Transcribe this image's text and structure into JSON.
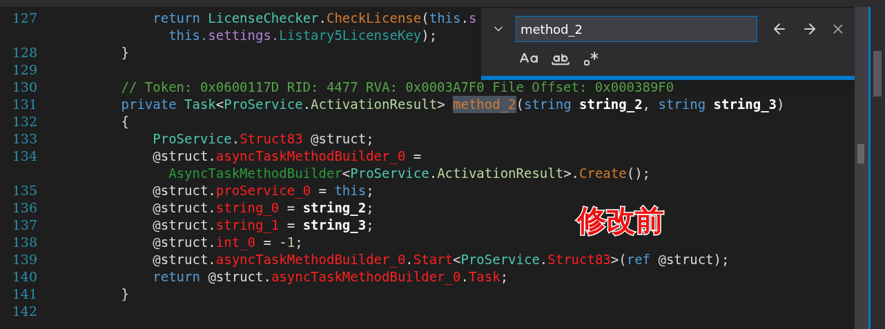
{
  "editor": {
    "lines": [
      {
        "number": "127",
        "tokens": [
          {
            "kind": "keyword",
            "text": "            return "
          },
          {
            "kind": "type",
            "text": "LicenseChecker"
          },
          {
            "kind": "plain",
            "text": "."
          },
          {
            "kind": "method",
            "text": "CheckLicense"
          },
          {
            "kind": "plain",
            "text": "("
          },
          {
            "kind": "keyword",
            "text": "this"
          },
          {
            "kind": "plain",
            "text": "."
          },
          {
            "kind": "property",
            "text": "s"
          }
        ]
      },
      {
        "tokens": [
          {
            "kind": "keyword",
            "text": "              this."
          },
          {
            "kind": "property",
            "text": "settings."
          },
          {
            "kind": "member",
            "text": "Listary5LicenseKey"
          },
          {
            "kind": "plain",
            "text": ");"
          }
        ]
      },
      {
        "number": "128",
        "tokens": [
          {
            "kind": "plain",
            "text": "        }"
          }
        ]
      },
      {
        "number": "129"
      },
      {
        "number": "130",
        "tokens": [
          {
            "kind": "comment",
            "text": "        // Token: 0x0600117D RID: 4477 RVA: 0x0003A7F0 File Offset: 0x000389F0"
          }
        ]
      },
      {
        "number": "131",
        "tokens": [
          {
            "kind": "keyword",
            "text": "        private "
          },
          {
            "kind": "type",
            "text": "Task"
          },
          {
            "kind": "plain",
            "text": "<"
          },
          {
            "kind": "type",
            "text": "ProService"
          },
          {
            "kind": "plain",
            "text": "."
          },
          {
            "kind": "nested",
            "text": "ActivationResult"
          },
          {
            "kind": "plain",
            "text": "> "
          },
          {
            "kind": "match",
            "text": "method_2"
          },
          {
            "kind": "plain",
            "text": "("
          },
          {
            "kind": "keyword",
            "text": "string "
          },
          {
            "kind": "param",
            "text": "string_2"
          },
          {
            "kind": "plain",
            "text": ", "
          },
          {
            "kind": "keyword",
            "text": "string "
          },
          {
            "kind": "param",
            "text": "string_3"
          },
          {
            "kind": "plain",
            "text": ")"
          }
        ]
      },
      {
        "number": "132",
        "tokens": [
          {
            "kind": "plain",
            "text": "        {"
          }
        ]
      },
      {
        "number": "133",
        "tokens": [
          {
            "kind": "type",
            "text": "            ProService"
          },
          {
            "kind": "plain",
            "text": "."
          },
          {
            "kind": "field",
            "text": "Struct83"
          },
          {
            "kind": "plain",
            "text": " @struct;"
          }
        ]
      },
      {
        "number": "134",
        "tokens": [
          {
            "kind": "plain",
            "text": "            @struct."
          },
          {
            "kind": "field",
            "text": "asyncTaskMethodBuilder_0"
          },
          {
            "kind": "plain",
            "text": " ="
          }
        ]
      },
      {
        "tokens": [
          {
            "kind": "struct",
            "text": "              AsyncTaskMethodBuilder"
          },
          {
            "kind": "plain",
            "text": "<"
          },
          {
            "kind": "type",
            "text": "ProService"
          },
          {
            "kind": "plain",
            "text": "."
          },
          {
            "kind": "nested",
            "text": "ActivationResult"
          },
          {
            "kind": "plain",
            "text": ">."
          },
          {
            "kind": "method",
            "text": "Create"
          },
          {
            "kind": "plain",
            "text": "();"
          }
        ]
      },
      {
        "number": "135",
        "tokens": [
          {
            "kind": "plain",
            "text": "            @struct."
          },
          {
            "kind": "field",
            "text": "proService_0"
          },
          {
            "kind": "plain",
            "text": " = "
          },
          {
            "kind": "keyword",
            "text": "this"
          },
          {
            "kind": "plain",
            "text": ";"
          }
        ]
      },
      {
        "number": "136",
        "tokens": [
          {
            "kind": "plain",
            "text": "            @struct."
          },
          {
            "kind": "field",
            "text": "string_0"
          },
          {
            "kind": "plain",
            "text": " = "
          },
          {
            "kind": "param",
            "text": "string_2"
          },
          {
            "kind": "plain",
            "text": ";"
          }
        ]
      },
      {
        "number": "137",
        "tokens": [
          {
            "kind": "plain",
            "text": "            @struct."
          },
          {
            "kind": "field",
            "text": "string_1"
          },
          {
            "kind": "plain",
            "text": " = "
          },
          {
            "kind": "param",
            "text": "string_3"
          },
          {
            "kind": "plain",
            "text": ";"
          }
        ]
      },
      {
        "number": "138",
        "tokens": [
          {
            "kind": "plain",
            "text": "            @struct."
          },
          {
            "kind": "field",
            "text": "int_0"
          },
          {
            "kind": "plain",
            "text": " = -"
          },
          {
            "kind": "number",
            "text": "1"
          },
          {
            "kind": "plain",
            "text": ";"
          }
        ]
      },
      {
        "number": "139",
        "tokens": [
          {
            "kind": "plain",
            "text": "            @struct."
          },
          {
            "kind": "field",
            "text": "asyncTaskMethodBuilder_0"
          },
          {
            "kind": "plain",
            "text": "."
          },
          {
            "kind": "field",
            "text": "Start"
          },
          {
            "kind": "plain",
            "text": "<"
          },
          {
            "kind": "type",
            "text": "ProService"
          },
          {
            "kind": "plain",
            "text": "."
          },
          {
            "kind": "field",
            "text": "Struct83"
          },
          {
            "kind": "plain",
            "text": ">("
          },
          {
            "kind": "keyword",
            "text": "ref"
          },
          {
            "kind": "plain",
            "text": " @struct);"
          }
        ]
      },
      {
        "number": "140",
        "tokens": [
          {
            "kind": "keyword",
            "text": "            return"
          },
          {
            "kind": "plain",
            "text": " @struct."
          },
          {
            "kind": "field",
            "text": "asyncTaskMethodBuilder_0"
          },
          {
            "kind": "plain",
            "text": "."
          },
          {
            "kind": "field",
            "text": "Task"
          },
          {
            "kind": "plain",
            "text": ";"
          }
        ]
      },
      {
        "number": "141",
        "tokens": [
          {
            "kind": "plain",
            "text": "        }"
          }
        ]
      },
      {
        "number": "142"
      }
    ]
  },
  "find_widget": {
    "value": "method_2"
  },
  "annotation": "修改前"
}
